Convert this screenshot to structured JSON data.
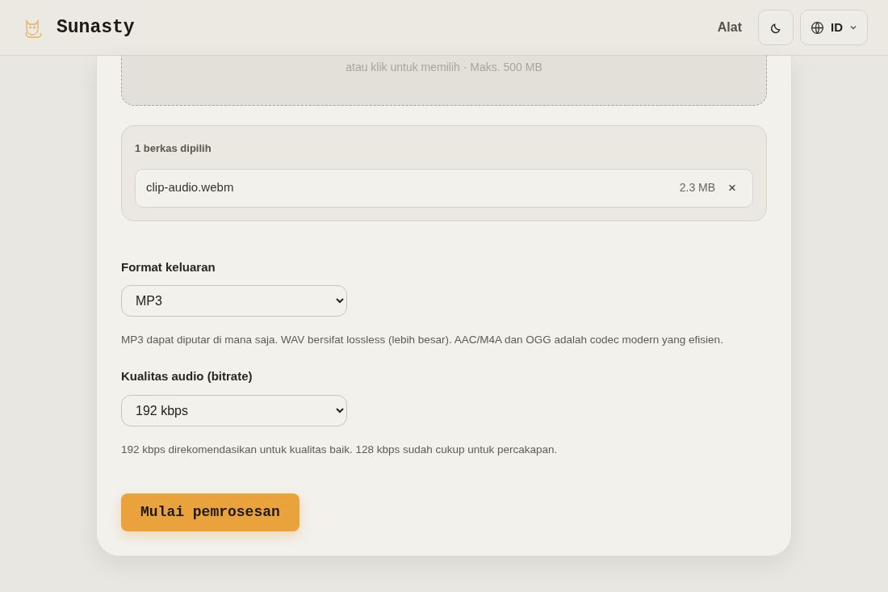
{
  "header": {
    "brand": "Sunasty",
    "nav": [
      {
        "label": "Alat"
      }
    ],
    "language": "ID"
  },
  "dropzone": {
    "hint": "atau klik untuk memilih · Maks. 500 MB"
  },
  "files": {
    "summary": "1 berkas dipilih",
    "items": [
      {
        "name": "clip-audio.webm",
        "size": "2.3 MB",
        "remove": "×"
      }
    ]
  },
  "fields": [
    {
      "label": "Format keluaran",
      "value": "MP3",
      "help": "MP3 dapat diputar di mana saja. WAV bersifat lossless (lebih besar). AAC/M4A dan OGG adalah codec modern yang efisien."
    },
    {
      "label": "Kualitas audio (bitrate)",
      "value": "192 kbps",
      "help": "192 kbps direkomendasikan untuk kualitas baik. 128 kbps sudah cukup untuk percakapan."
    }
  ],
  "submit": "Mulai pemrosesan"
}
